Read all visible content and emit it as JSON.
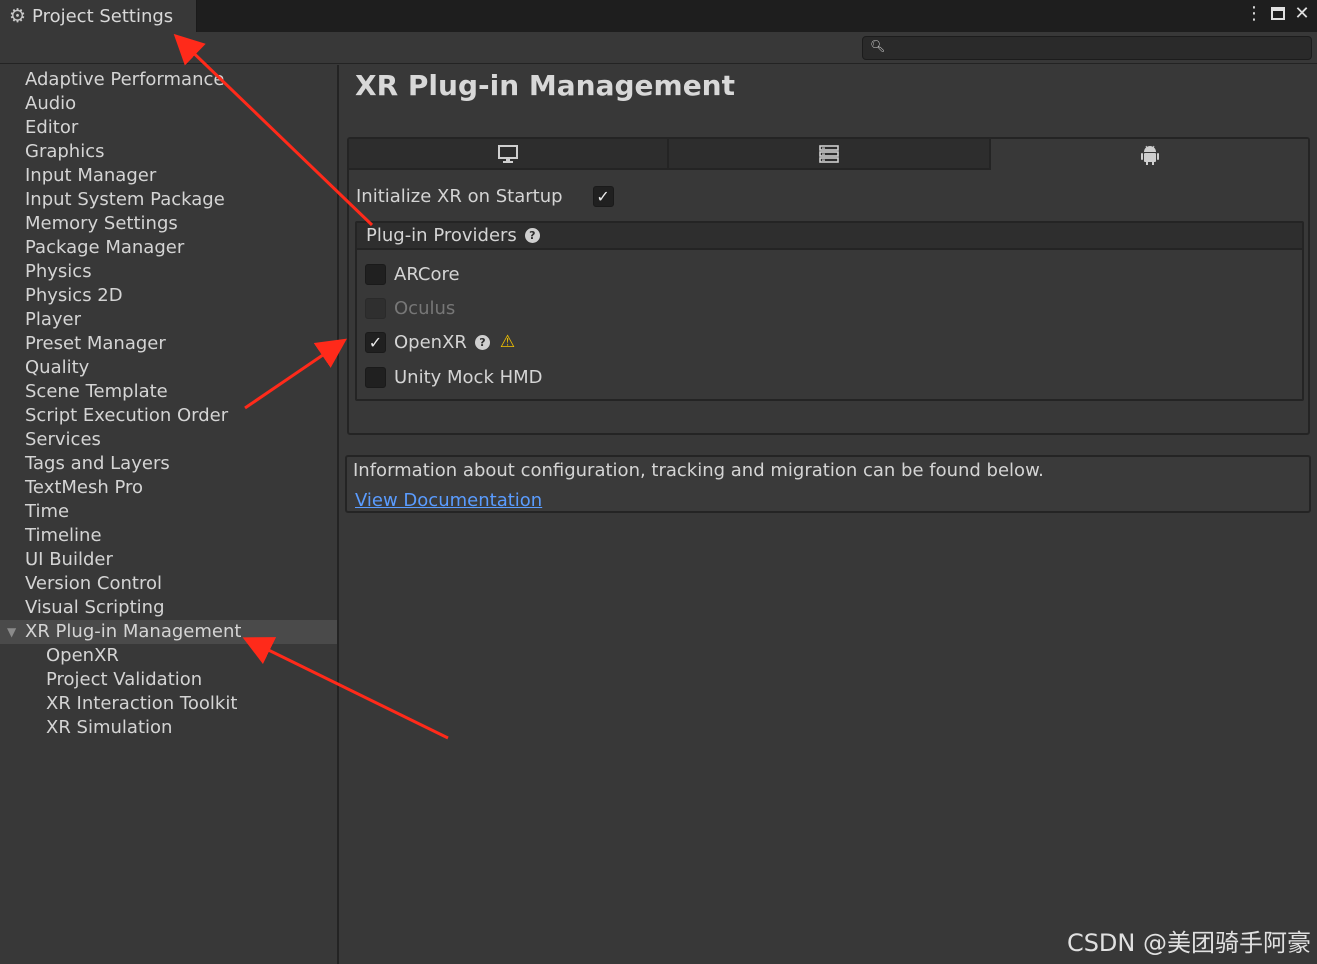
{
  "window": {
    "tab_title": "Project Settings",
    "icons": {
      "tab": "gear-icon",
      "menu": "kebab-menu-icon",
      "maximize": "maximize-icon",
      "close": "close-icon"
    }
  },
  "toolbar": {
    "search_placeholder": "",
    "search_icon": "magnifier-icon"
  },
  "sidebar": {
    "items": [
      {
        "label": "Adaptive Performance"
      },
      {
        "label": "Audio"
      },
      {
        "label": "Editor"
      },
      {
        "label": "Graphics"
      },
      {
        "label": "Input Manager"
      },
      {
        "label": "Input System Package"
      },
      {
        "label": "Memory Settings"
      },
      {
        "label": "Package Manager"
      },
      {
        "label": "Physics"
      },
      {
        "label": "Physics 2D"
      },
      {
        "label": "Player"
      },
      {
        "label": "Preset Manager"
      },
      {
        "label": "Quality"
      },
      {
        "label": "Scene Template"
      },
      {
        "label": "Script Execution Order"
      },
      {
        "label": "Services"
      },
      {
        "label": "Tags and Layers"
      },
      {
        "label": "TextMesh Pro"
      },
      {
        "label": "Time"
      },
      {
        "label": "Timeline"
      },
      {
        "label": "UI Builder"
      },
      {
        "label": "Version Control"
      },
      {
        "label": "Visual Scripting"
      },
      {
        "label": "XR Plug-in Management",
        "selected": true,
        "expanded": true
      },
      {
        "label": "OpenXR",
        "child": true
      },
      {
        "label": "Project Validation",
        "child": true
      },
      {
        "label": "XR Interaction Toolkit",
        "child": true
      },
      {
        "label": "XR Simulation",
        "child": true
      }
    ]
  },
  "main": {
    "title": "XR Plug-in Management",
    "platform_tabs": [
      {
        "icon": "desktop-icon",
        "active": false
      },
      {
        "icon": "server-icon",
        "active": false
      },
      {
        "icon": "android-icon",
        "active": true
      }
    ],
    "init_on_startup": {
      "label": "Initialize XR on Startup",
      "checked": true
    },
    "providers": {
      "header": "Plug-in Providers",
      "items": [
        {
          "label": "ARCore",
          "checked": false,
          "disabled": false
        },
        {
          "label": "Oculus",
          "checked": false,
          "disabled": true
        },
        {
          "label": "OpenXR",
          "checked": true,
          "disabled": false,
          "has_help": true,
          "has_warning": true
        },
        {
          "label": "Unity Mock HMD",
          "checked": false,
          "disabled": false
        }
      ]
    },
    "info": {
      "text": "Information about configuration, tracking and migration can be found below.",
      "link": "View Documentation"
    }
  },
  "watermark": "CSDN @美团骑手阿豪",
  "colors": {
    "background": "#383838",
    "annotation_arrow": "#ff2a1a",
    "link": "#5a9cff",
    "warning": "#f2c200"
  }
}
